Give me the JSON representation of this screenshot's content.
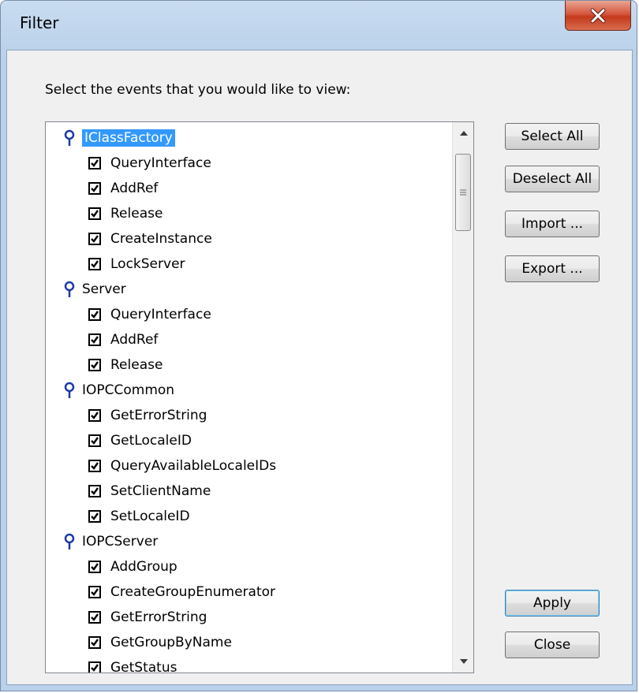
{
  "window": {
    "title": "Filter"
  },
  "prompt": "Select the events that you would like to view:",
  "buttons": {
    "select_all": "Select All",
    "deselect_all": "Deselect All",
    "import": "Import ...",
    "export": "Export ...",
    "apply": "Apply",
    "close": "Close"
  },
  "tree": {
    "groups": [
      {
        "label": "IClassFactory",
        "selected": true,
        "items": [
          "QueryInterface",
          "AddRef",
          "Release",
          "CreateInstance",
          "LockServer"
        ]
      },
      {
        "label": "Server",
        "items": [
          "QueryInterface",
          "AddRef",
          "Release"
        ]
      },
      {
        "label": "IOPCCommon",
        "items": [
          "GetErrorString",
          "GetLocaleID",
          "QueryAvailableLocaleIDs",
          "SetClientName",
          "SetLocaleID"
        ]
      },
      {
        "label": "IOPCServer",
        "items": [
          "AddGroup",
          "CreateGroupEnumerator",
          "GetErrorString",
          "GetGroupByName",
          "GetStatus"
        ]
      }
    ]
  },
  "colors": {
    "selection": "#3399ff",
    "pin": "#1a3aa8"
  }
}
